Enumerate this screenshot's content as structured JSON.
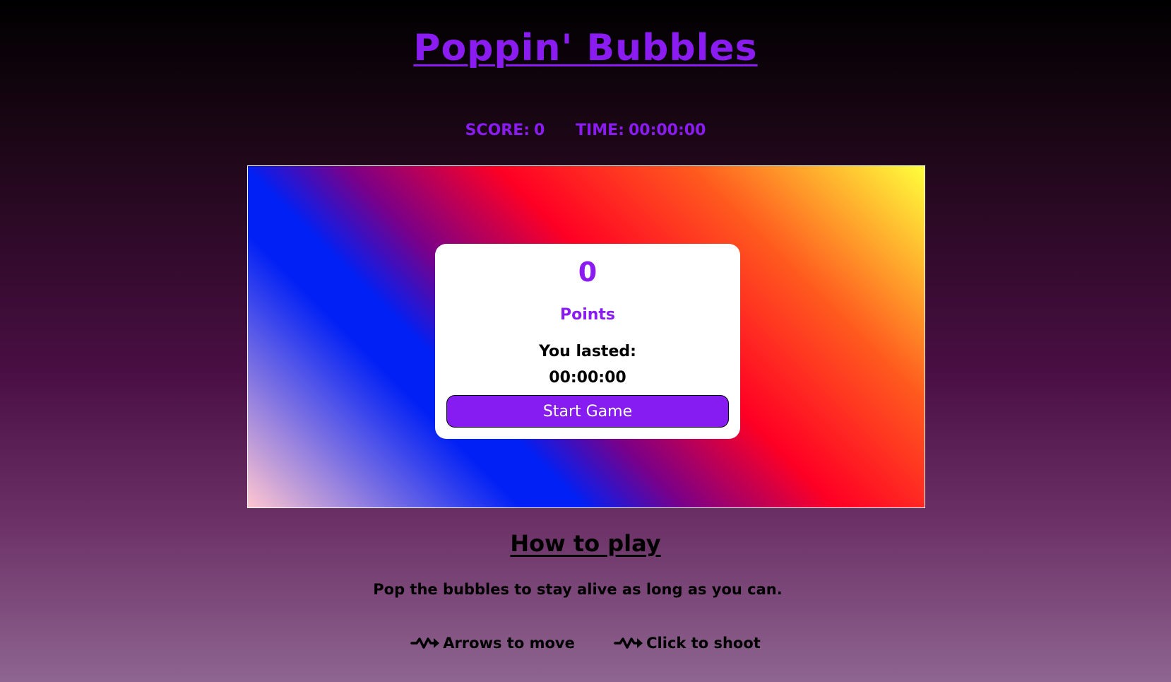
{
  "title": "Poppin' Bubbles",
  "stats": {
    "score_label": "SCORE:",
    "score_value": "0",
    "time_label": "TIME:",
    "time_value": "00:00:00"
  },
  "card": {
    "points_value": "0",
    "points_label": "Points",
    "lasted_label": "You lasted:",
    "lasted_value": "00:00:00",
    "start_button": "Start Game"
  },
  "instructions": {
    "heading": "How to play",
    "description": "Pop the bubbles to stay alive as long as you can.",
    "controls": [
      {
        "icon": "zigzag-arrow-icon",
        "label": "Arrows to move"
      },
      {
        "icon": "zigzag-arrow-icon",
        "label": "Click to shoot"
      }
    ]
  },
  "colors": {
    "accent": "#8a1cf2",
    "button": "#861cf2"
  }
}
